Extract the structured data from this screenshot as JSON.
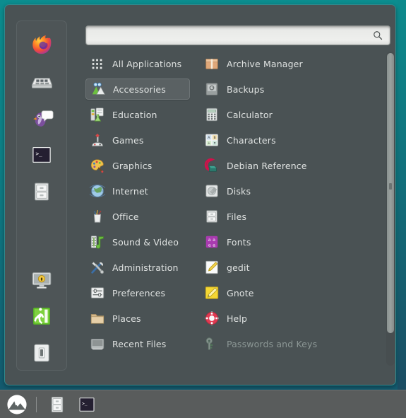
{
  "desktop": {
    "background_color": "#0d7f86",
    "accent_color": "#31898d"
  },
  "menu": {
    "title": "Application Menu",
    "search": {
      "value": "",
      "placeholder": "",
      "icon": "search-icon"
    },
    "favorites": [
      {
        "name": "firefox",
        "label": "Firefox Web Browser",
        "icon": "firefox-icon"
      },
      {
        "name": "keyboard",
        "label": "Keyboard Layout",
        "icon": "keyboard-icon"
      },
      {
        "name": "pidgin",
        "label": "Pidgin Internet Messenger",
        "icon": "pidgin-penguin-icon"
      },
      {
        "name": "terminal",
        "label": "Terminal",
        "icon": "terminal-icon"
      },
      {
        "name": "files",
        "label": "Files",
        "icon": "file-cabinet-icon"
      },
      {
        "name": "lock-screen",
        "label": "Lock Screen",
        "icon": "lock-screen-icon"
      },
      {
        "name": "logout",
        "label": "Log Out",
        "icon": "exit-door-icon"
      },
      {
        "name": "quit",
        "label": "Quit",
        "icon": "power-switch-icon"
      }
    ],
    "categories": [
      {
        "label": "All Applications",
        "icon": "grid-dots-icon",
        "selected": false
      },
      {
        "label": "Accessories",
        "icon": "accessories-icon",
        "selected": true
      },
      {
        "label": "Education",
        "icon": "education-icon",
        "selected": false
      },
      {
        "label": "Games",
        "icon": "games-joystick-icon",
        "selected": false
      },
      {
        "label": "Graphics",
        "icon": "graphics-palette-icon",
        "selected": false
      },
      {
        "label": "Internet",
        "icon": "internet-globe-icon",
        "selected": false
      },
      {
        "label": "Office",
        "icon": "office-icon",
        "selected": false
      },
      {
        "label": "Sound & Video",
        "icon": "sound-video-icon",
        "selected": false
      },
      {
        "label": "Administration",
        "icon": "administration-tools-icon",
        "selected": false
      },
      {
        "label": "Preferences",
        "icon": "preferences-icon",
        "selected": false
      },
      {
        "label": "Places",
        "icon": "folder-icon",
        "selected": false
      },
      {
        "label": "Recent Files",
        "icon": "recent-files-icon",
        "selected": false
      }
    ],
    "applications": [
      {
        "label": "Archive Manager",
        "icon": "archive-box-icon",
        "dim": false
      },
      {
        "label": "Backups",
        "icon": "backups-icon",
        "dim": false
      },
      {
        "label": "Calculator",
        "icon": "calculator-icon",
        "dim": false
      },
      {
        "label": "Characters",
        "icon": "characters-icon",
        "dim": false
      },
      {
        "label": "Debian Reference",
        "icon": "debian-swirl-icon",
        "dim": false
      },
      {
        "label": "Disks",
        "icon": "disks-icon",
        "dim": false
      },
      {
        "label": "Files",
        "icon": "files-icon",
        "dim": false
      },
      {
        "label": "Fonts",
        "icon": "fonts-icon",
        "dim": false
      },
      {
        "label": "gedit",
        "icon": "gedit-pencil-icon",
        "dim": false
      },
      {
        "label": "Gnote",
        "icon": "gnote-icon",
        "dim": false
      },
      {
        "label": "Help",
        "icon": "help-lifering-icon",
        "dim": false
      },
      {
        "label": "Passwords and Keys",
        "icon": "key-icon",
        "dim": true
      }
    ],
    "scrollbar": {
      "name": "apps-scrollbar",
      "position_percent": 0
    }
  },
  "taskbar": {
    "menu_button": {
      "label": "Menu",
      "icon": "mint-logo-icon"
    },
    "items": [
      {
        "label": "Files",
        "icon": "file-cabinet-icon"
      },
      {
        "label": "Terminal",
        "icon": "terminal-icon"
      }
    ]
  }
}
